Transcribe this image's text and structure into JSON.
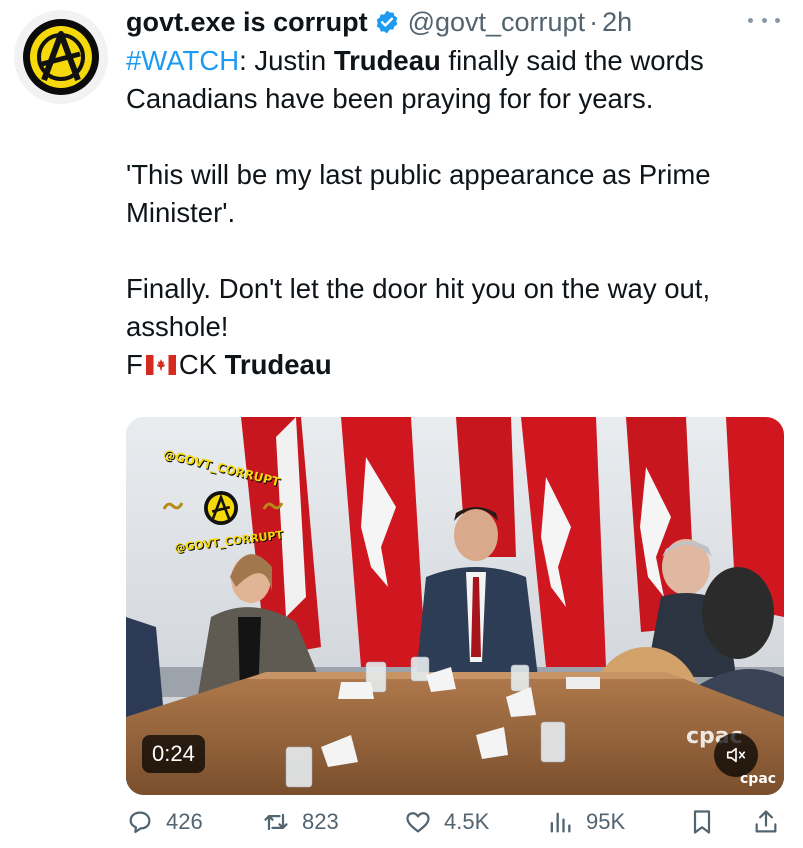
{
  "author": {
    "display_name": "govt.exe is corrupt",
    "handle": "@govt_corrupt",
    "separator": "·",
    "time": "2h",
    "avatar_icon": "anarchy-symbol-icon"
  },
  "tweet": {
    "hashtag": "#WATCH",
    "line1_rest_a": ": Justin ",
    "line1_bold": "Trudeau",
    "line1_rest_b": " finally said the words Canadians have been praying for for years.",
    "quote": "'This will be my last public appearance as Prime Minister'.",
    "para3": "Finally. Don't let the door hit you on the way out, asshole!",
    "last_prefix": "F",
    "last_flag": "canada-flag-icon",
    "last_mid": "CK ",
    "last_bold": "Trudeau"
  },
  "media": {
    "watermark_top": "@GOVT_CORRUPT",
    "watermark_bottom": "@GOVT_CORRUPT",
    "duration": "0:24",
    "network_logo": "cpac",
    "network_logo_small": "cpac",
    "mute_icon": "speaker-muted-icon"
  },
  "actions": {
    "replies": "426",
    "reposts": "823",
    "likes": "4.5K",
    "views": "95K"
  },
  "colors": {
    "accent": "#1d9bf0",
    "secondary_text": "#536471",
    "avatar_yellow": "#f5d90a",
    "flag_red": "#d52b1e"
  }
}
